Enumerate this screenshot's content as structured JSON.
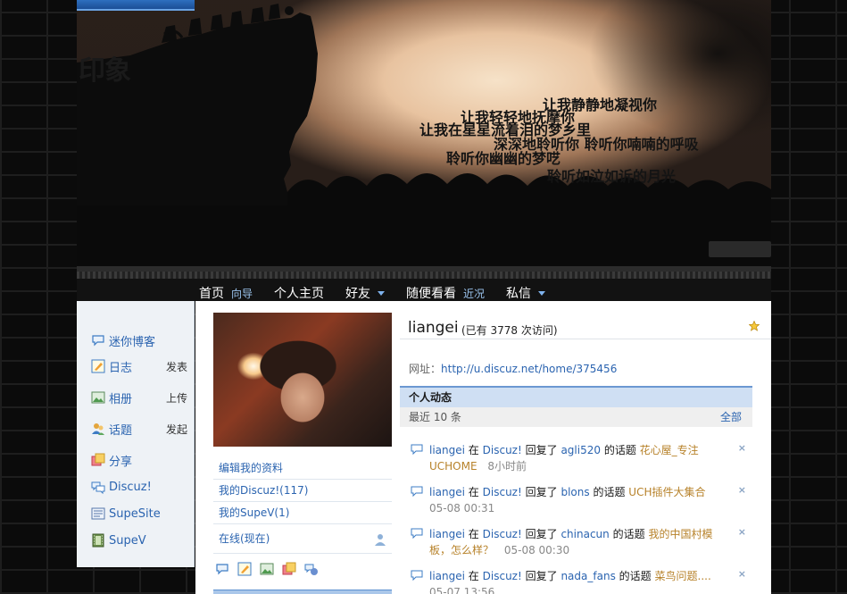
{
  "header": {
    "site_title": "印象",
    "poem": [
      "让我静静地凝视你",
      "让我轻轻地抚摩你",
      "让我在星星流着泪的梦乡里",
      "深深地聆听你 聆听你喃喃的呼吸",
      "聆听你幽幽的梦呓",
      "聆听如泣如诉的月光"
    ]
  },
  "nav": {
    "items": [
      {
        "label": "首页",
        "sub": "向导"
      },
      {
        "label": "个人主页"
      },
      {
        "label": "好友"
      },
      {
        "label": "随便看看",
        "sub": "近况"
      },
      {
        "label": "私信"
      }
    ]
  },
  "sidebar": {
    "items": [
      {
        "label": "迷你博客",
        "icon": "microblog-icon"
      },
      {
        "label": "日志",
        "action": "发表",
        "icon": "blog-icon"
      },
      {
        "label": "相册",
        "action": "上传",
        "icon": "album-icon"
      },
      {
        "label": "话题",
        "action": "发起",
        "icon": "topic-icon"
      },
      {
        "label": "分享",
        "icon": "share-icon"
      },
      {
        "label": "Discuz!",
        "icon": "discuz-icon"
      },
      {
        "label": "SupeSite",
        "icon": "supesite-icon"
      },
      {
        "label": "SupeV",
        "icon": "supev-icon"
      }
    ]
  },
  "profile": {
    "username": "liangei",
    "visits": "(已有 3778 次访问)",
    "url_label": "网址：",
    "url": "http://u.discuz.net/home/375456",
    "links": [
      "编辑我的资料",
      "我的Discuz!(117)",
      "我的SupeV(1)",
      "在线(现在)"
    ]
  },
  "feed": {
    "heading": "个人动态",
    "subheading": "最近 10 条",
    "all_label": "全部",
    "entries": [
      {
        "user": "liangei",
        "in": "在",
        "forum": "Discuz!",
        "verb": "回复了",
        "target": "agli520",
        "of": "的话题",
        "title": "花心屋_专注UCHOME",
        "time": "8小时前"
      },
      {
        "user": "liangei",
        "in": "在",
        "forum": "Discuz!",
        "verb": "回复了",
        "target": "blons",
        "of": "的话题",
        "title": "UCH插件大集合",
        "time": "05-08 00:31"
      },
      {
        "user": "liangei",
        "in": "在",
        "forum": "Discuz!",
        "verb": "回复了",
        "target": "chinacun",
        "of": "的话题",
        "title": "我的中国村模板，怎么样？",
        "time": "05-08 00:30"
      },
      {
        "user": "liangei",
        "in": "在",
        "forum": "Discuz!",
        "verb": "回复了",
        "target": "nada_fans",
        "of": "的话题",
        "title": "菜鸟问题....",
        "time": "05-07 13:56"
      }
    ]
  },
  "colors": {
    "link": "#2b64b0",
    "title_link": "#b7822a",
    "nav_bg": "#121212"
  }
}
